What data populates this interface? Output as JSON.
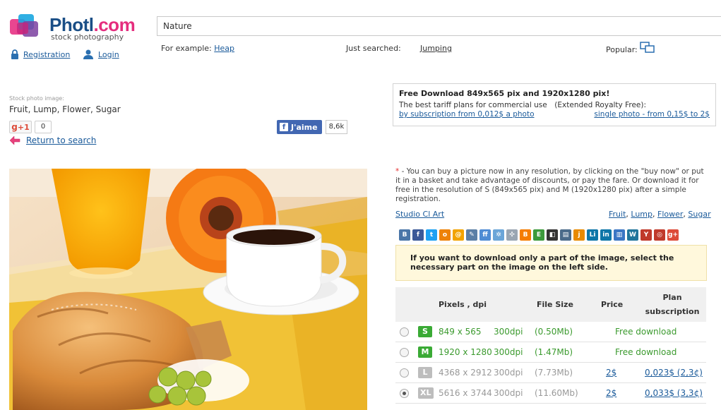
{
  "header": {
    "logo_text": "Photl",
    "logo_dot": ".com",
    "logo_sub": "stock photography",
    "registration": "Registration",
    "login": "Login",
    "search_value": "Nature",
    "example_label": "For example:",
    "example_link": "Heap",
    "just_label": "Just searched:",
    "just_link": "Jumping",
    "popular_label": "Popular:"
  },
  "left": {
    "crumb_label": "Stock photo image:",
    "crumb_tags": "Fruit, Lump, Flower, Sugar",
    "gplus_label": "+1",
    "gplus_count": "0",
    "return_label": "Return to search",
    "fb_label": "J'aime",
    "fb_count": "8,6k"
  },
  "promo": {
    "title": "Free Download 849x565 pix and 1920x1280 pix!",
    "line": "The best tariff plans for commercial use",
    "line_right": "(Extended Royalty Free):",
    "link_left": "by subscription from 0,012$ a photo",
    "link_right": "single photo - from 0,15$ to 2$"
  },
  "info": {
    "asterisk": "*",
    "note": " - You can buy a picture now in any resolution, by clicking on the \"buy now\" or put it in a basket and take advantage of discounts, or pay the fare. Or download it for free in the resolution of S (849x565 pix) and M (1920x1280 pix) after a simple registration.",
    "author": "Studio Cl Art",
    "tags": [
      "Fruit",
      "Lump",
      "Flower",
      "Sugar"
    ],
    "tip": "If you want to download only a part of the image, select the necessary part on the image on the left side."
  },
  "shares": [
    {
      "icon": "vkontakte-icon",
      "glyph": "B",
      "color": "#4a76a8"
    },
    {
      "icon": "facebook-icon",
      "glyph": "f",
      "color": "#3b5998"
    },
    {
      "icon": "twitter-icon",
      "glyph": "t",
      "color": "#1da1f2"
    },
    {
      "icon": "odnoklassniki-icon",
      "glyph": "o",
      "color": "#ee8208"
    },
    {
      "icon": "mailru-icon",
      "glyph": "@",
      "color": "#f2a300"
    },
    {
      "icon": "livejournal-icon",
      "glyph": "✎",
      "color": "#5b7fa6"
    },
    {
      "icon": "friendfeed-icon",
      "glyph": "ff",
      "color": "#4e8cd4"
    },
    {
      "icon": "gear-share-icon",
      "glyph": "✲",
      "color": "#6aa5d8"
    },
    {
      "icon": "puzzle-icon",
      "glyph": "✣",
      "color": "#9aa6b2"
    },
    {
      "icon": "blogger-icon",
      "glyph": "B",
      "color": "#f57d00"
    },
    {
      "icon": "evernote-icon",
      "glyph": "E",
      "color": "#3c9a3c"
    },
    {
      "icon": "delicious-icon",
      "glyph": "◧",
      "color": "#333333"
    },
    {
      "icon": "liveinternet-icon",
      "glyph": "▤",
      "color": "#4b6b8a"
    },
    {
      "icon": "juick-icon",
      "glyph": "j",
      "color": "#e88a00"
    },
    {
      "icon": "linkedin-icon",
      "glyph": "Li",
      "color": "#0e76a8"
    },
    {
      "icon": "linkedin-in-icon",
      "glyph": "in",
      "color": "#0e76a8"
    },
    {
      "icon": "bars-icon",
      "glyph": "▥",
      "color": "#3b76c4"
    },
    {
      "icon": "wordpress-icon",
      "glyph": "W",
      "color": "#21759b"
    },
    {
      "icon": "yahoo-icon",
      "glyph": "Y",
      "color": "#c0392b"
    },
    {
      "icon": "target-icon",
      "glyph": "◎",
      "color": "#c0392b"
    },
    {
      "icon": "googleplus-icon",
      "glyph": "g+",
      "color": "#dd4b39"
    }
  ],
  "table": {
    "headers": {
      "pixels": "Pixels , dpi",
      "size": "File Size",
      "price": "Price",
      "plan": "Plan subscription"
    },
    "rows": [
      {
        "badge": "S",
        "badge_color": "#3aaa35",
        "pixels": "849 x 565",
        "dpi": "300dpi",
        "size": "(0.50Mb)",
        "price": "Free download",
        "plan": "",
        "selected": false,
        "free": true
      },
      {
        "badge": "M",
        "badge_color": "#3aaa35",
        "pixels": "1920 x 1280",
        "dpi": "300dpi",
        "size": "(1.47Mb)",
        "price": "Free download",
        "plan": "",
        "selected": false,
        "free": true
      },
      {
        "badge": "L",
        "badge_color": "#bdbdbd",
        "pixels": "4368 x 2912",
        "dpi": "300dpi",
        "size": "(7.73Mb)",
        "price": "2$",
        "plan": "0,023$ (2,3¢)",
        "selected": false,
        "free": false
      },
      {
        "badge": "XL",
        "badge_color": "#bdbdbd",
        "pixels": "5616 x 3744",
        "dpi": "300dpi",
        "size": "(11.60Mb)",
        "price": "2$",
        "plan": "0,033$ (3,3¢)",
        "selected": true,
        "free": false
      }
    ]
  }
}
